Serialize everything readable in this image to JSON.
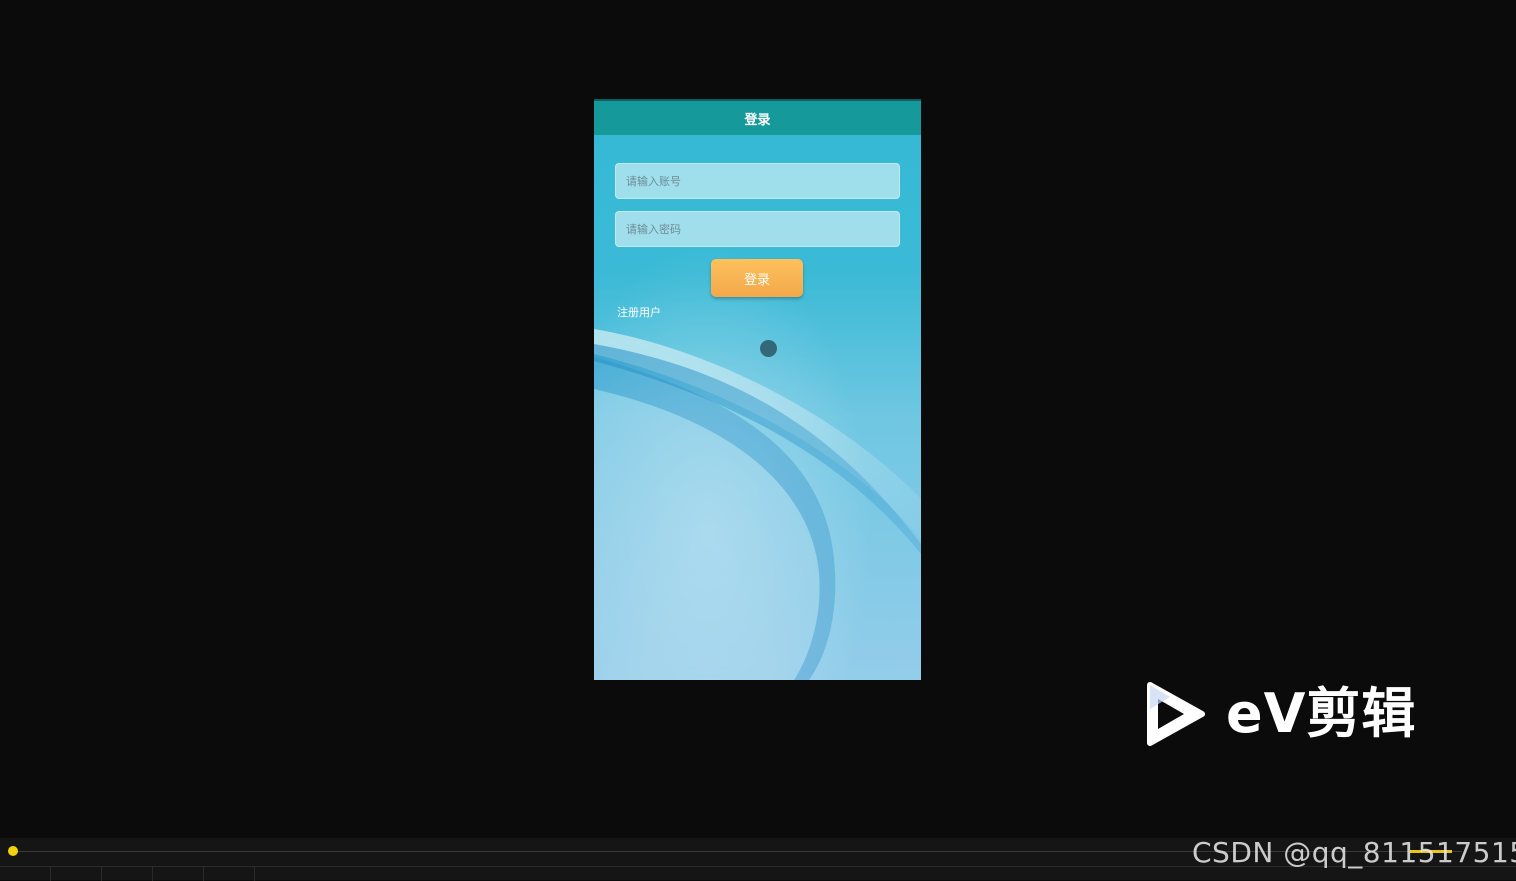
{
  "app": {
    "title": "登录"
  },
  "form": {
    "account_placeholder": "请输入账号",
    "password_placeholder": "请输入密码",
    "login_button": "登录",
    "register_link": "注册用户"
  },
  "watermarks": {
    "editor_brand": "eV剪辑",
    "csdn": "CSDN @qq_811517515"
  },
  "icons": {
    "play": "play-logo-icon"
  },
  "colors": {
    "titlebar": "#16999a",
    "login_button": "#f7b04f",
    "background_top": "#34b9d4",
    "background_bottom": "#93cdea"
  }
}
